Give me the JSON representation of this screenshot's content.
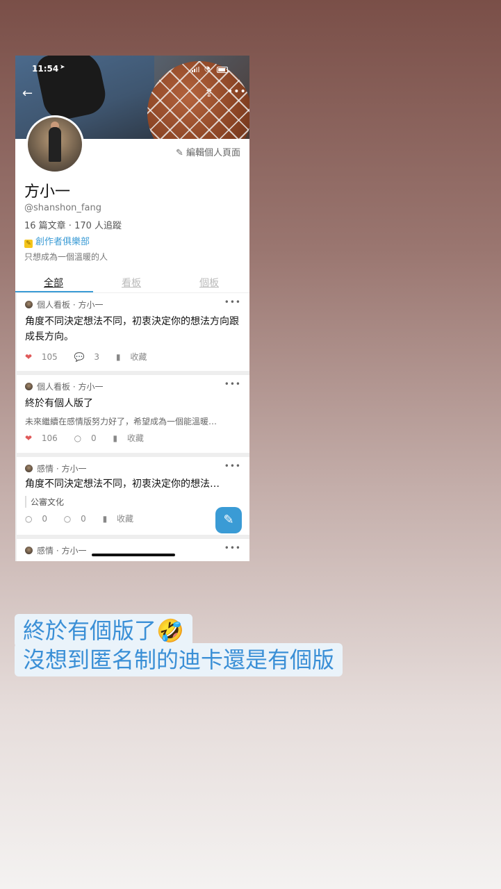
{
  "status": {
    "time": "11:54",
    "location_icon": "location-arrow-icon"
  },
  "profile": {
    "edit_label": "編輯個人頁面",
    "name": "方小一",
    "handle": "@shanshon_fang",
    "stats": "16 篇文章 · 170 人追蹤",
    "club": "創作者俱樂部",
    "bio": "只想成為一個溫暖的人"
  },
  "tabs": [
    {
      "label": "全部",
      "active": true
    },
    {
      "label": "看板",
      "active": false
    },
    {
      "label": "個板",
      "active": false
    }
  ],
  "posts": [
    {
      "meta": "個人看板 · 方小一",
      "title": "角度不同決定想法不同，初衷決定你的想法方向跟成長方向。",
      "likes": "105",
      "comments": "3",
      "save": "收藏"
    },
    {
      "meta": "個人看板 · 方小一",
      "title": "終於有個人版了",
      "excerpt": "未來繼續在感情版努力好了，希望成為一個能溫暖…",
      "likes": "106",
      "comments": "0",
      "save": "收藏"
    },
    {
      "meta": "感情 · 方小一",
      "title": "角度不同決定想法不同，初衷決定你的想法…",
      "tag": "公審文化",
      "likes": "0",
      "comments": "0",
      "save": "收藏"
    },
    {
      "meta": "感情 · 方小一"
    }
  ],
  "caption": {
    "line1": "終於有個版了🤣",
    "line2": "沒想到匿名制的迪卡還是有個版"
  },
  "colors": {
    "accent": "#3a9bd5",
    "heart": "#e05a5a"
  }
}
